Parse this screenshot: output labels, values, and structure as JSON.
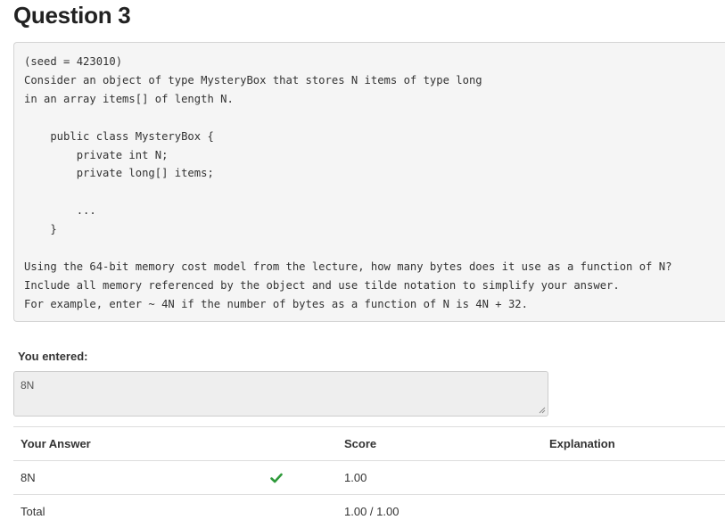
{
  "question": {
    "title": "Question 3",
    "problem_lines": [
      "(seed = 423010)",
      "Consider an object of type MysteryBox that stores N items of type long",
      "in an array items[] of length N.",
      "",
      "    public class MysteryBox {",
      "        private int N;",
      "        private long[] items;",
      "",
      "        ...",
      "    }",
      "",
      "Using the 64-bit memory cost model from the lecture, how many bytes does it use as a function of N?",
      "Include all memory referenced by the object and use tilde notation to simplify your answer.",
      "For example, enter ~ 4N if the number of bytes as a function of N is 4N + 32."
    ]
  },
  "response": {
    "label": "You entered:",
    "value": "8N"
  },
  "results": {
    "headers": {
      "answer": "Your Answer",
      "score": "Score",
      "explanation": "Explanation"
    },
    "rows": [
      {
        "answer": "8N",
        "status_icon": "checkmark-icon",
        "status_color": "#2e9a3a",
        "score": "1.00",
        "explanation": ""
      }
    ],
    "total": {
      "label": "Total",
      "score": "1.00 / 1.00"
    }
  }
}
